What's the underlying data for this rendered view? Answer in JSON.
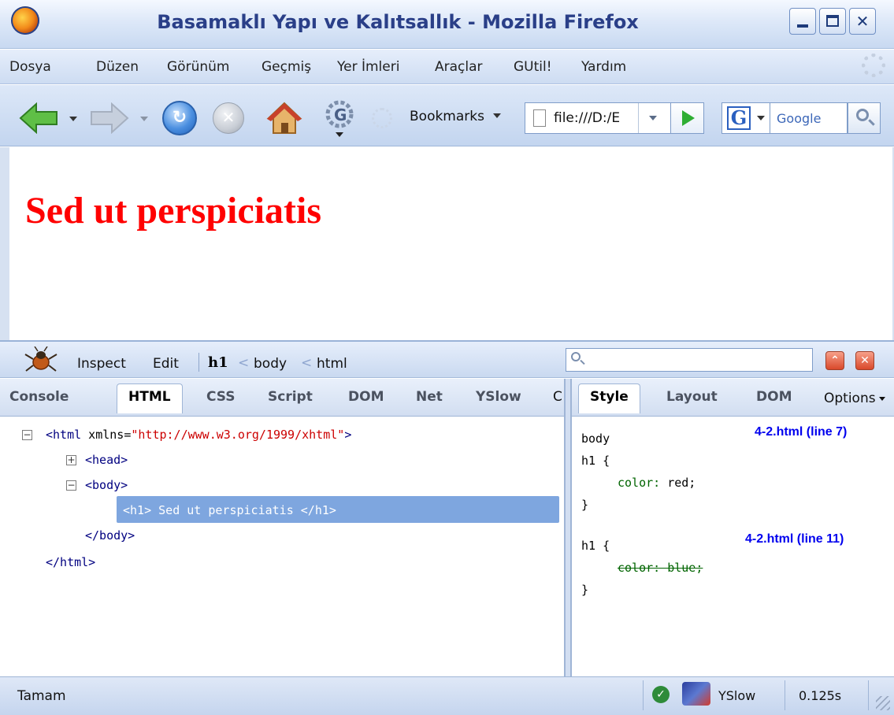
{
  "window": {
    "title": "Basamaklı Yapı ve Kalıtsallık - Mozilla Firefox"
  },
  "menu": {
    "items": [
      "Dosya",
      "Düzen",
      "Görünüm",
      "Geçmiş",
      "Yer İmleri",
      "Araçlar",
      "GUtil!",
      "Yardım"
    ]
  },
  "toolbar": {
    "bookmarks_label": "Bookmarks",
    "url": "file:///D:/E",
    "search_placeholder": "Google"
  },
  "page": {
    "heading": "Sed ut perspiciatis",
    "heading_color": "#ff0000"
  },
  "firebug": {
    "inspect_label": "Inspect",
    "edit_label": "Edit",
    "breadcrumb": [
      "h1",
      "body",
      "html"
    ],
    "left_tabs": [
      "Console",
      "HTML",
      "CSS",
      "Script",
      "DOM",
      "Net",
      "YSlow",
      "C"
    ],
    "left_active_tab": "HTML",
    "right_tabs": [
      "Style",
      "Layout",
      "DOM"
    ],
    "right_active_tab": "Style",
    "options_label": "Options",
    "html_tree": {
      "html_open_tag": "<html",
      "html_attr_name": " xmlns=",
      "html_attr_value": "\"http://www.w3.org/1999/xhtml\"",
      "html_open_close": ">",
      "head_tag": "<head>",
      "body_open": "<body>",
      "h1_line": "<h1> Sed ut perspiciatis </h1>",
      "body_close": "</body>",
      "html_close": "</html>"
    },
    "style_rules": [
      {
        "selector_line1": "body",
        "selector_line2": "h1 {",
        "declaration_prop": "color:",
        "declaration_value": " red;",
        "close": "}",
        "source": "4-2.html (line 7)"
      },
      {
        "selector_line1": "h1 {",
        "declaration_overridden": "color: blue;",
        "close": "}",
        "source": "4-2.html (line 11)"
      }
    ]
  },
  "status": {
    "text": "Tamam",
    "yslow_label": "YSlow",
    "load_time": "0.125s"
  },
  "colors": {
    "accent": "#7ea6df",
    "chrome_blue": "#c9d9f0",
    "link_blue": "#0000ee",
    "css_property_green": "#006400"
  },
  "icons": [
    "firefox-logo-icon",
    "minimize-icon",
    "maximize-icon",
    "close-icon",
    "back-arrow-icon",
    "forward-arrow-icon",
    "reload-icon",
    "stop-icon",
    "home-icon",
    "gutil-icon",
    "page-icon",
    "go-arrow-icon",
    "google-icon",
    "search-icon",
    "firebug-icon",
    "check-icon",
    "yslow-icon",
    "resize-grip-icon"
  ]
}
